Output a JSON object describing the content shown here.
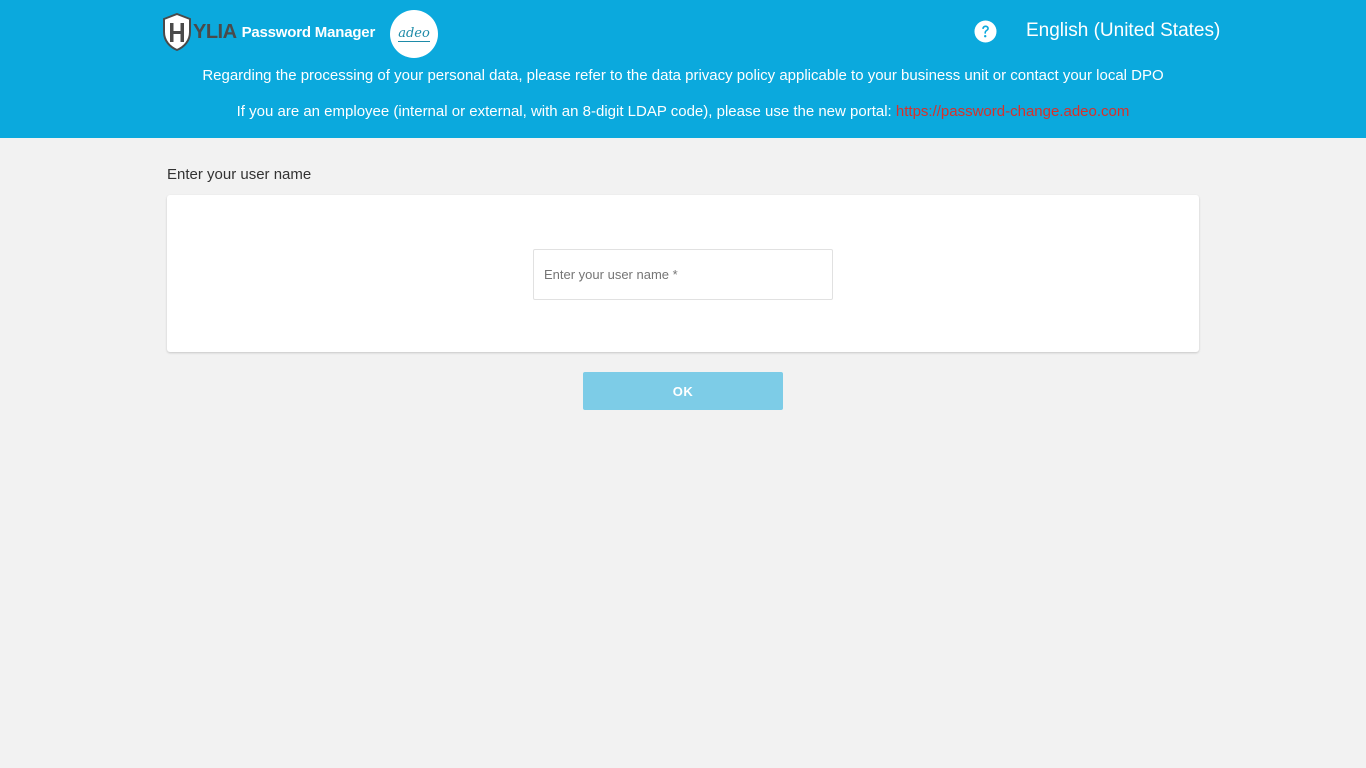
{
  "header": {
    "logo": {
      "brand": "YLIA",
      "product": "Password Manager",
      "icon": "shield-h-icon"
    },
    "partner_logo": {
      "text": "adeo"
    },
    "help": {
      "icon": "question-circle-icon"
    },
    "language": "English (United States)",
    "privacy_notice": "Regarding the processing of your personal data, please refer to the data privacy policy applicable to your business unit or contact your local DPO",
    "employee_notice": {
      "text": "If you are an employee (internal or external, with an 8-digit LDAP code), please use the new portal: ",
      "link": "https://password-change.adeo.com"
    }
  },
  "main": {
    "section_label": "Enter your user name",
    "username": {
      "placeholder": "Enter your user name *",
      "value": ""
    },
    "submit_label": "OK"
  },
  "colors": {
    "header_bg": "#0ba9dd",
    "page_bg": "#f2f2f2",
    "link": "#d9302a",
    "button_disabled": "#7dcce7"
  }
}
